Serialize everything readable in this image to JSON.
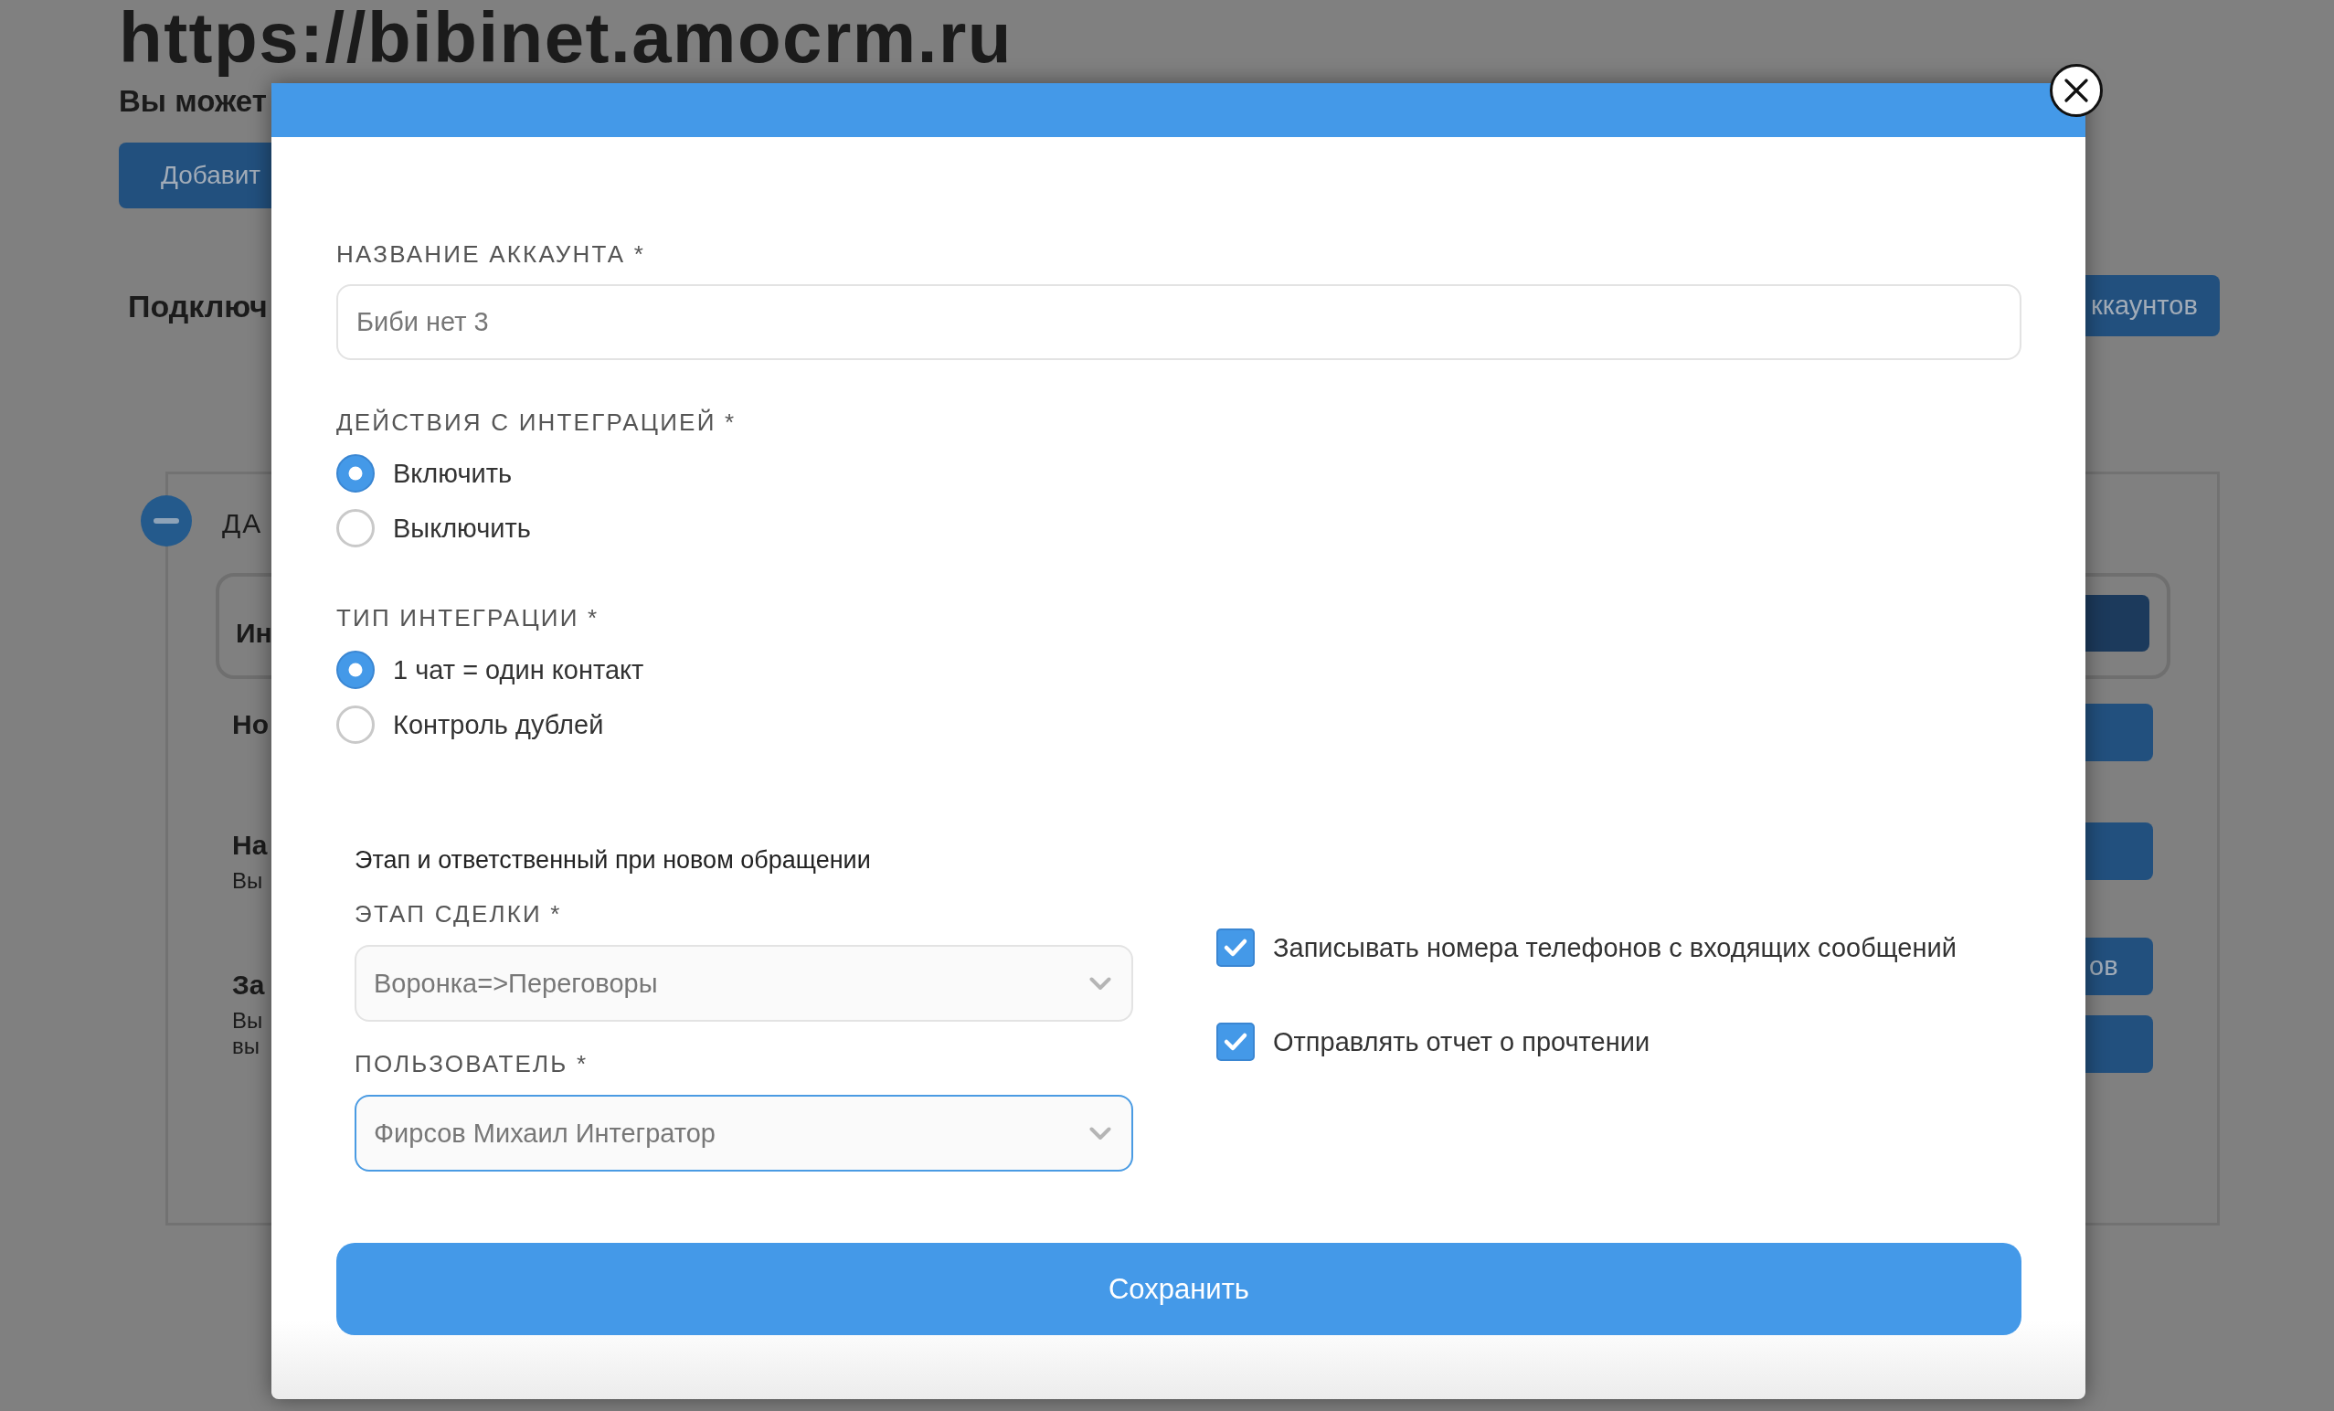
{
  "background_page": {
    "title": "https://bibinet.amocrm.ru",
    "subtitle": "Вы может",
    "add_button": "Добавит",
    "section_heading": "Подключ",
    "accounts_button": "ккаунтов",
    "panel": {
      "expanded": true,
      "heading": "ДА",
      "integration_box": {
        "title": "Ин",
        "buttons": [
          {
            "kind": "dark"
          }
        ]
      },
      "rows": [
        {
          "title": "Но",
          "buttons": [
            {
              "kind": "primary"
            }
          ]
        },
        {
          "title": "На",
          "description_lines": [
            "Вы"
          ],
          "buttons": [
            {
              "kind": "primary"
            }
          ]
        },
        {
          "title": "За",
          "description_lines": [
            "Вы",
            "вы"
          ],
          "buttons": [
            {
              "kind": "primary",
              "label": "ов"
            },
            {
              "kind": "primary"
            }
          ]
        }
      ]
    }
  },
  "dialog": {
    "account_name": {
      "label": "НАЗВАНИЕ АККАУНТА *",
      "value": "Биби нет 3"
    },
    "integration_action": {
      "label": "ДЕЙСТВИЯ С ИНТЕГРАЦИЕЙ *",
      "options": [
        {
          "label": "Включить",
          "selected": true
        },
        {
          "label": "Выключить",
          "selected": false
        }
      ]
    },
    "integration_type": {
      "label": "ТИП ИНТЕГРАЦИИ *",
      "options": [
        {
          "label": "1 чат = один контакт",
          "selected": true
        },
        {
          "label": "Контроль дублей",
          "selected": false
        }
      ]
    },
    "new_request": {
      "heading": "Этап и ответственный при новом обращении",
      "selects": [
        {
          "label": "ЭТАП СДЕЛКИ *",
          "value": "Воронка=>Переговоры",
          "focused": false
        },
        {
          "label": "ПОЛЬЗОВАТЕЛЬ *",
          "value": "Фирсов Михаил Интегратор",
          "focused": true
        }
      ],
      "checkboxes": [
        {
          "label": "Записывать номера телефонов с входящих сообщений",
          "checked": true
        },
        {
          "label": "Отправлять отчет о прочтении",
          "checked": true
        }
      ]
    },
    "save_button": "Сохранить"
  }
}
